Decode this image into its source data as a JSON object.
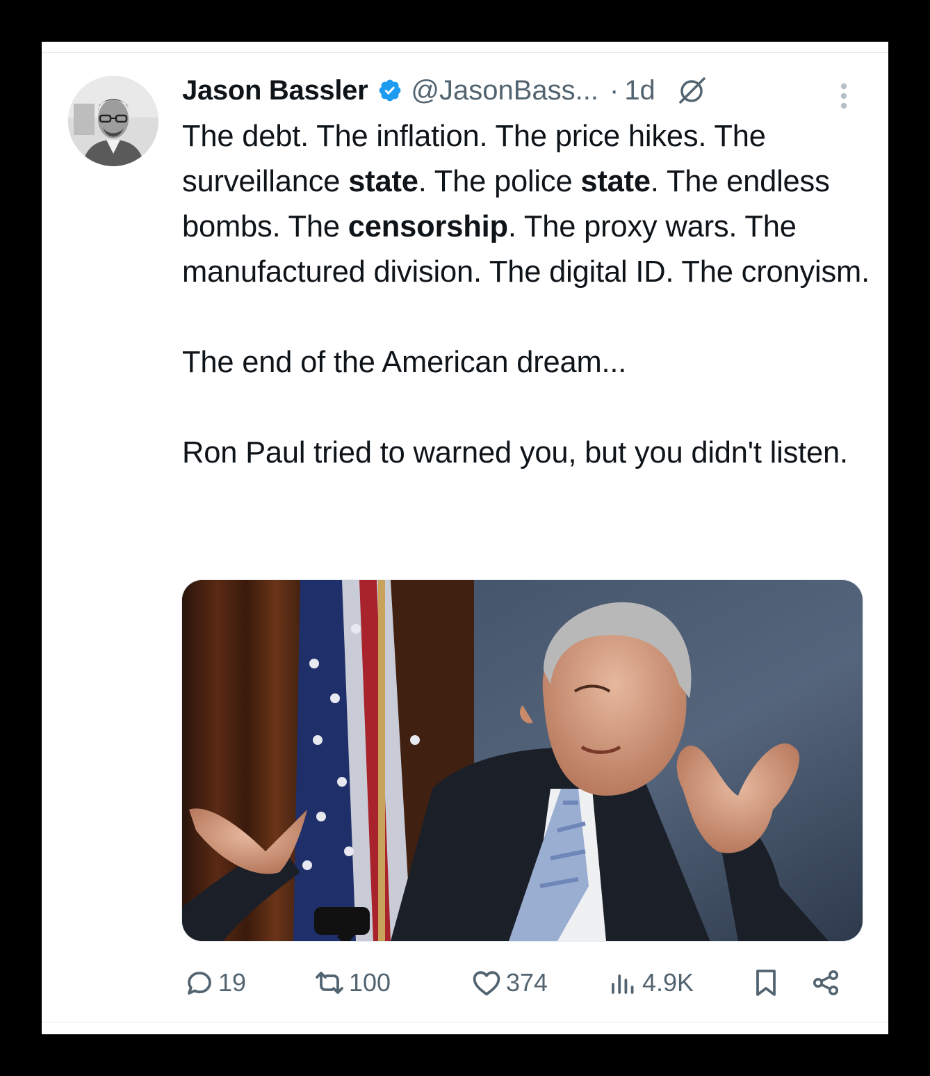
{
  "tweet": {
    "author_name": "Jason Bassler",
    "handle": "@JasonBass...",
    "separator": "·",
    "time": "1d",
    "paragraphs": [
      [
        {
          "t": "The debt. The inflation. The price hikes. The surveillance "
        },
        {
          "t": "state",
          "b": true
        },
        {
          "t": ". The police "
        },
        {
          "t": "state",
          "b": true
        },
        {
          "t": ". The endless bombs. The "
        },
        {
          "t": "censorship",
          "b": true
        },
        {
          "t": ". The proxy wars. The manufactured division. The digital ID. The cronyism."
        }
      ],
      [
        {
          "t": "The end of the American dream..."
        }
      ],
      [
        {
          "t": "Ron Paul tried to warned you, but you didn't listen."
        }
      ]
    ],
    "media_icon": "photo-of-speaker-shrugging-before-us-flag"
  },
  "actions": {
    "replies": "19",
    "reposts": "100",
    "likes": "374",
    "views": "4.9K"
  },
  "icons": {
    "verified": "verified-badge-icon",
    "grok": "grok-icon",
    "more": "more-vertical-icon",
    "reply": "reply-icon",
    "repost": "repost-icon",
    "like": "heart-icon",
    "views": "views-icon",
    "bookmark": "bookmark-icon",
    "share": "share-icon"
  },
  "colors": {
    "verified_blue": "#1d9bf0",
    "text": "#0f1419",
    "secondary": "#536471"
  }
}
